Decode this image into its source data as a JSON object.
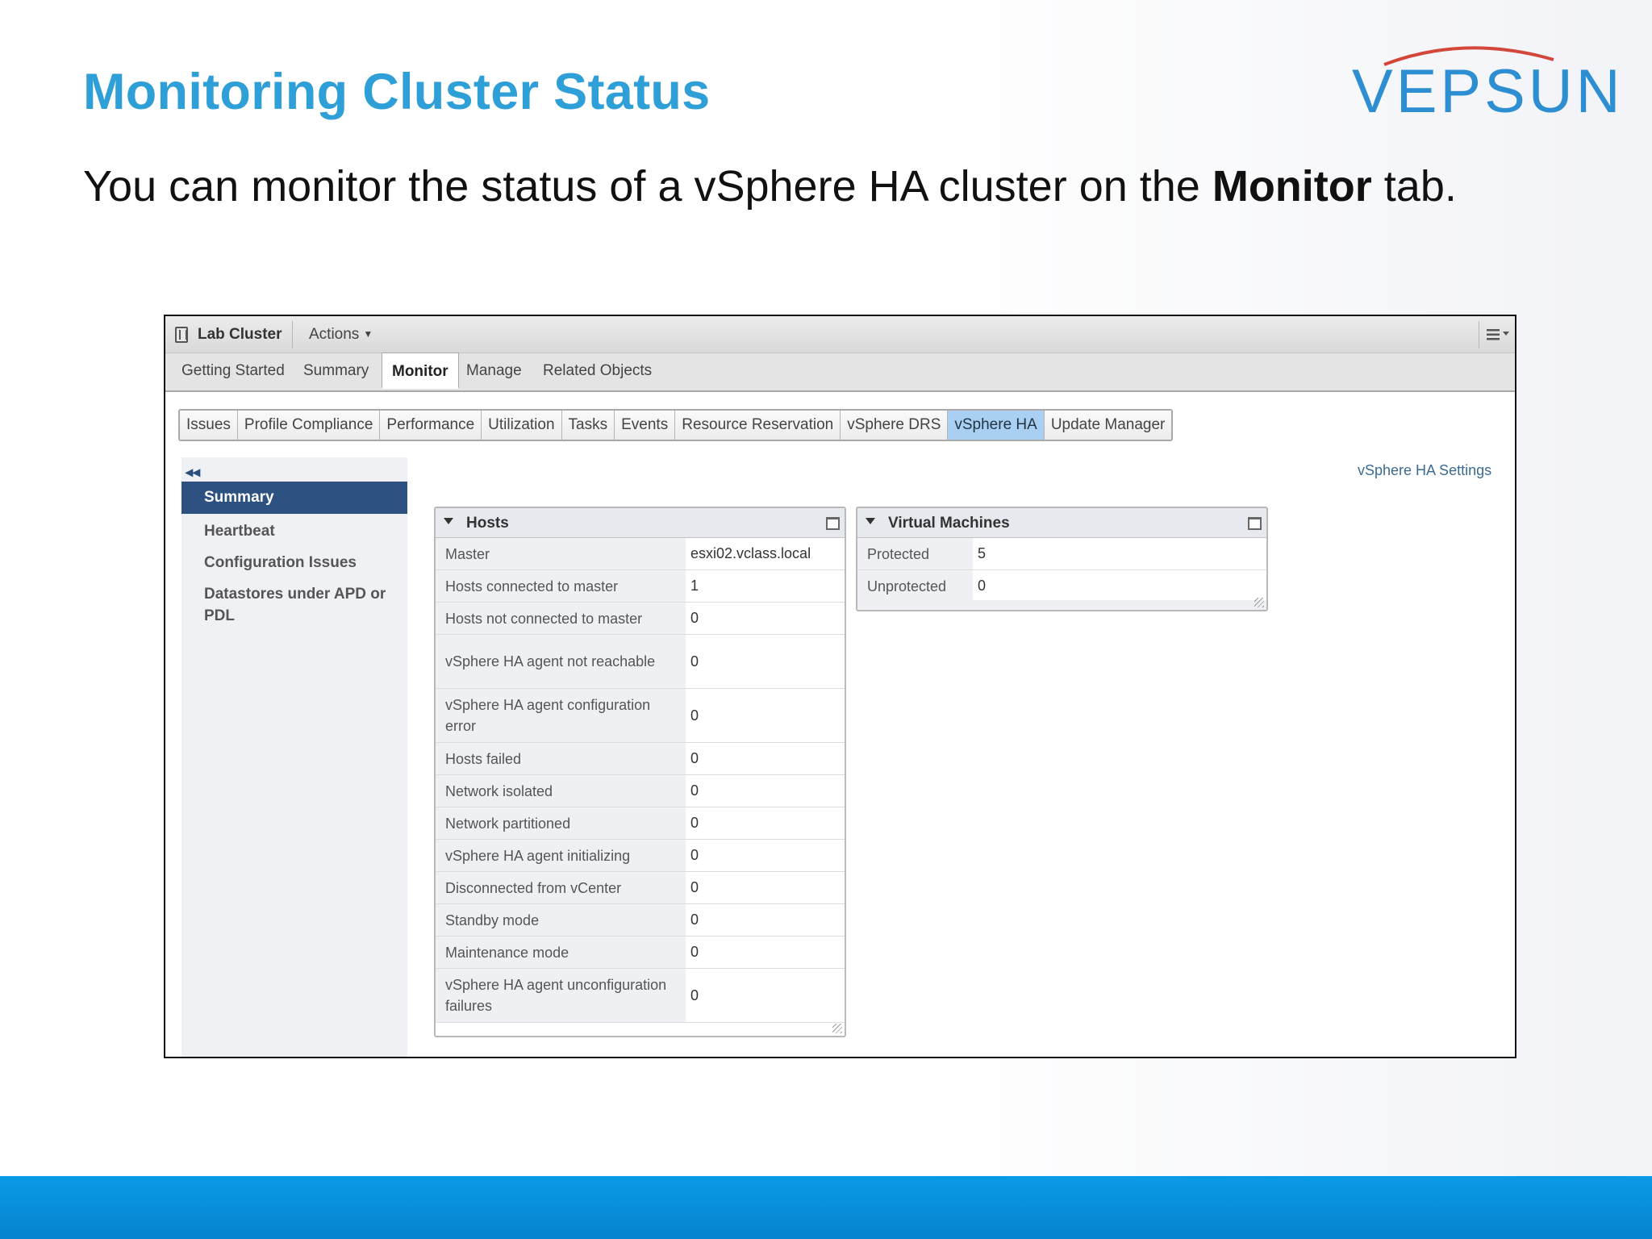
{
  "slide": {
    "title": "Monitoring Cluster Status",
    "logo_text": "VEPSUN",
    "subtitle_pre": "You can monitor the status of a vSphere HA cluster on the ",
    "subtitle_bold": "Monitor",
    "subtitle_post": " tab."
  },
  "window": {
    "cluster_name": "Lab Cluster",
    "actions_label": "Actions"
  },
  "tabs": [
    "Getting Started",
    "Summary",
    "Monitor",
    "Manage",
    "Related Objects"
  ],
  "subtabs": [
    "Issues",
    "Profile Compliance",
    "Performance",
    "Utilization",
    "Tasks",
    "Events",
    "Resource Reservation",
    "vSphere DRS",
    "vSphere HA",
    "Update Manager"
  ],
  "sidebar": {
    "items": [
      "Summary",
      "Heartbeat",
      "Configuration Issues",
      "Datastores under APD or PDL"
    ]
  },
  "settings_link": "vSphere HA Settings",
  "hosts_panel": {
    "title": "Hosts",
    "rows": [
      {
        "k": "Master",
        "v": "esxi02.vclass.local"
      },
      {
        "k": "Hosts connected to master",
        "v": "1"
      },
      {
        "k": "Hosts not connected to master",
        "v": "0"
      },
      {
        "k": "vSphere HA agent not reachable",
        "v": "0"
      },
      {
        "k": "vSphere HA agent configuration error",
        "v": "0"
      },
      {
        "k": "Hosts failed",
        "v": "0"
      },
      {
        "k": "Network isolated",
        "v": "0"
      },
      {
        "k": "Network partitioned",
        "v": "0"
      },
      {
        "k": "vSphere HA agent initializing",
        "v": "0"
      },
      {
        "k": "Disconnected from vCenter",
        "v": "0"
      },
      {
        "k": "Standby mode",
        "v": "0"
      },
      {
        "k": "Maintenance mode",
        "v": "0"
      },
      {
        "k": "vSphere HA agent unconfiguration failures",
        "v": "0"
      }
    ]
  },
  "vm_panel": {
    "title": "Virtual Machines",
    "rows": [
      {
        "k": "Protected",
        "v": "5"
      },
      {
        "k": "Unprotected",
        "v": "0"
      }
    ]
  },
  "colors": {
    "title_blue": "#2f9fd8",
    "sidebar_active": "#2d5181",
    "subtab_active": "#a9d0f2",
    "footer_blue": "#0683cd"
  }
}
